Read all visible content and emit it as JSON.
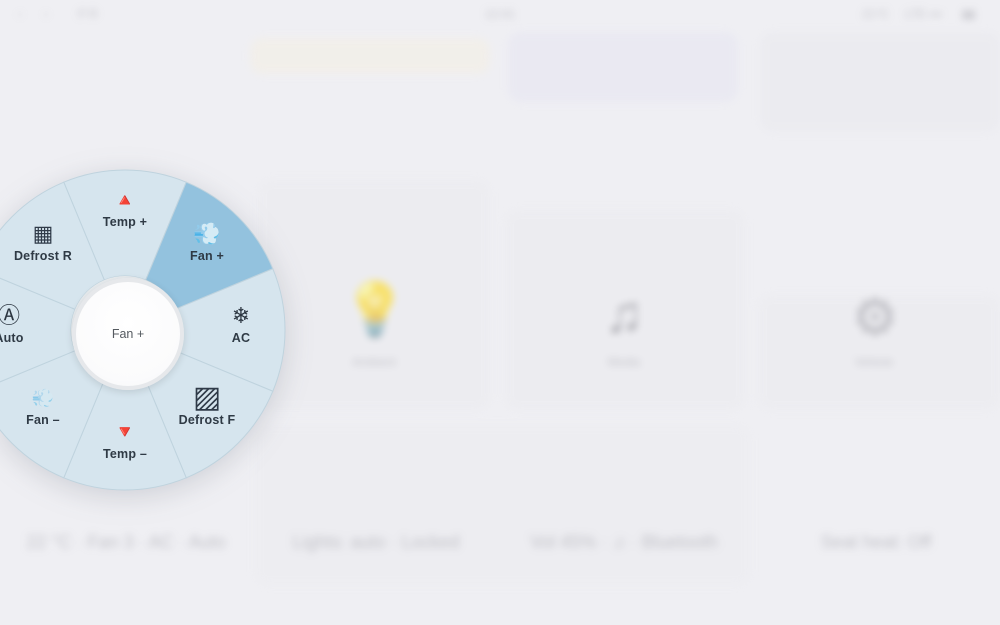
{
  "top_bar": {
    "left_a": "‹",
    "left_b": "› ",
    "left_c": "P R",
    "center": "12:41",
    "right_a": "21°C",
    "right_b": "LTE ▪▪▪",
    "right_c": "▮▮"
  },
  "tiles": [
    {
      "label": "Ambient",
      "icon": "light-bulb-icon",
      "glyph": "💡"
    },
    {
      "label": "Media",
      "icon": "music-note-icon",
      "glyph": "♫"
    },
    {
      "label": "Vehicle",
      "icon": "gear-icon",
      "glyph": "⚙"
    }
  ],
  "status_bar": {
    "climate": "22 °C · Fan 3 · AC · Auto",
    "lights": "Lights: auto · Locked",
    "media": "Vol 45% · ♫ · Bluetooth",
    "seat": "Seat heat: Off"
  },
  "radial_menu": {
    "center_label": "Fan +",
    "segments": [
      {
        "id": "temp-up",
        "label": "Temp +",
        "glyph": "🔺",
        "icon": "triangle-up-icon",
        "active": false
      },
      {
        "id": "fan-up",
        "label": "Fan +",
        "glyph": "💨",
        "icon": "wind-icon",
        "active": true
      },
      {
        "id": "ac",
        "label": "AC",
        "glyph": "❄",
        "icon": "snowflake-icon",
        "active": false
      },
      {
        "id": "defrost-front",
        "label": "Defrost F",
        "glyph": "▨",
        "icon": "defrost-front-icon",
        "active": false
      },
      {
        "id": "temp-down",
        "label": "Temp –",
        "glyph": "🔻",
        "icon": "triangle-down-icon",
        "active": false
      },
      {
        "id": "fan-down",
        "label": "Fan –",
        "glyph": "💨",
        "icon": "wind-low-icon",
        "active": false
      },
      {
        "id": "auto",
        "label": "Auto",
        "glyph": "Ⓐ",
        "icon": "auto-mode-icon",
        "active": false
      },
      {
        "id": "defrost-rear",
        "label": "Defrost R",
        "glyph": "▦",
        "icon": "defrost-rear-icon",
        "active": false
      }
    ],
    "colors": {
      "segment_fill": "#d6e5ee",
      "segment_active_fill": "#93c2de",
      "segment_divider": "#bfd3de",
      "arrow_red": "#e02b1f"
    }
  }
}
